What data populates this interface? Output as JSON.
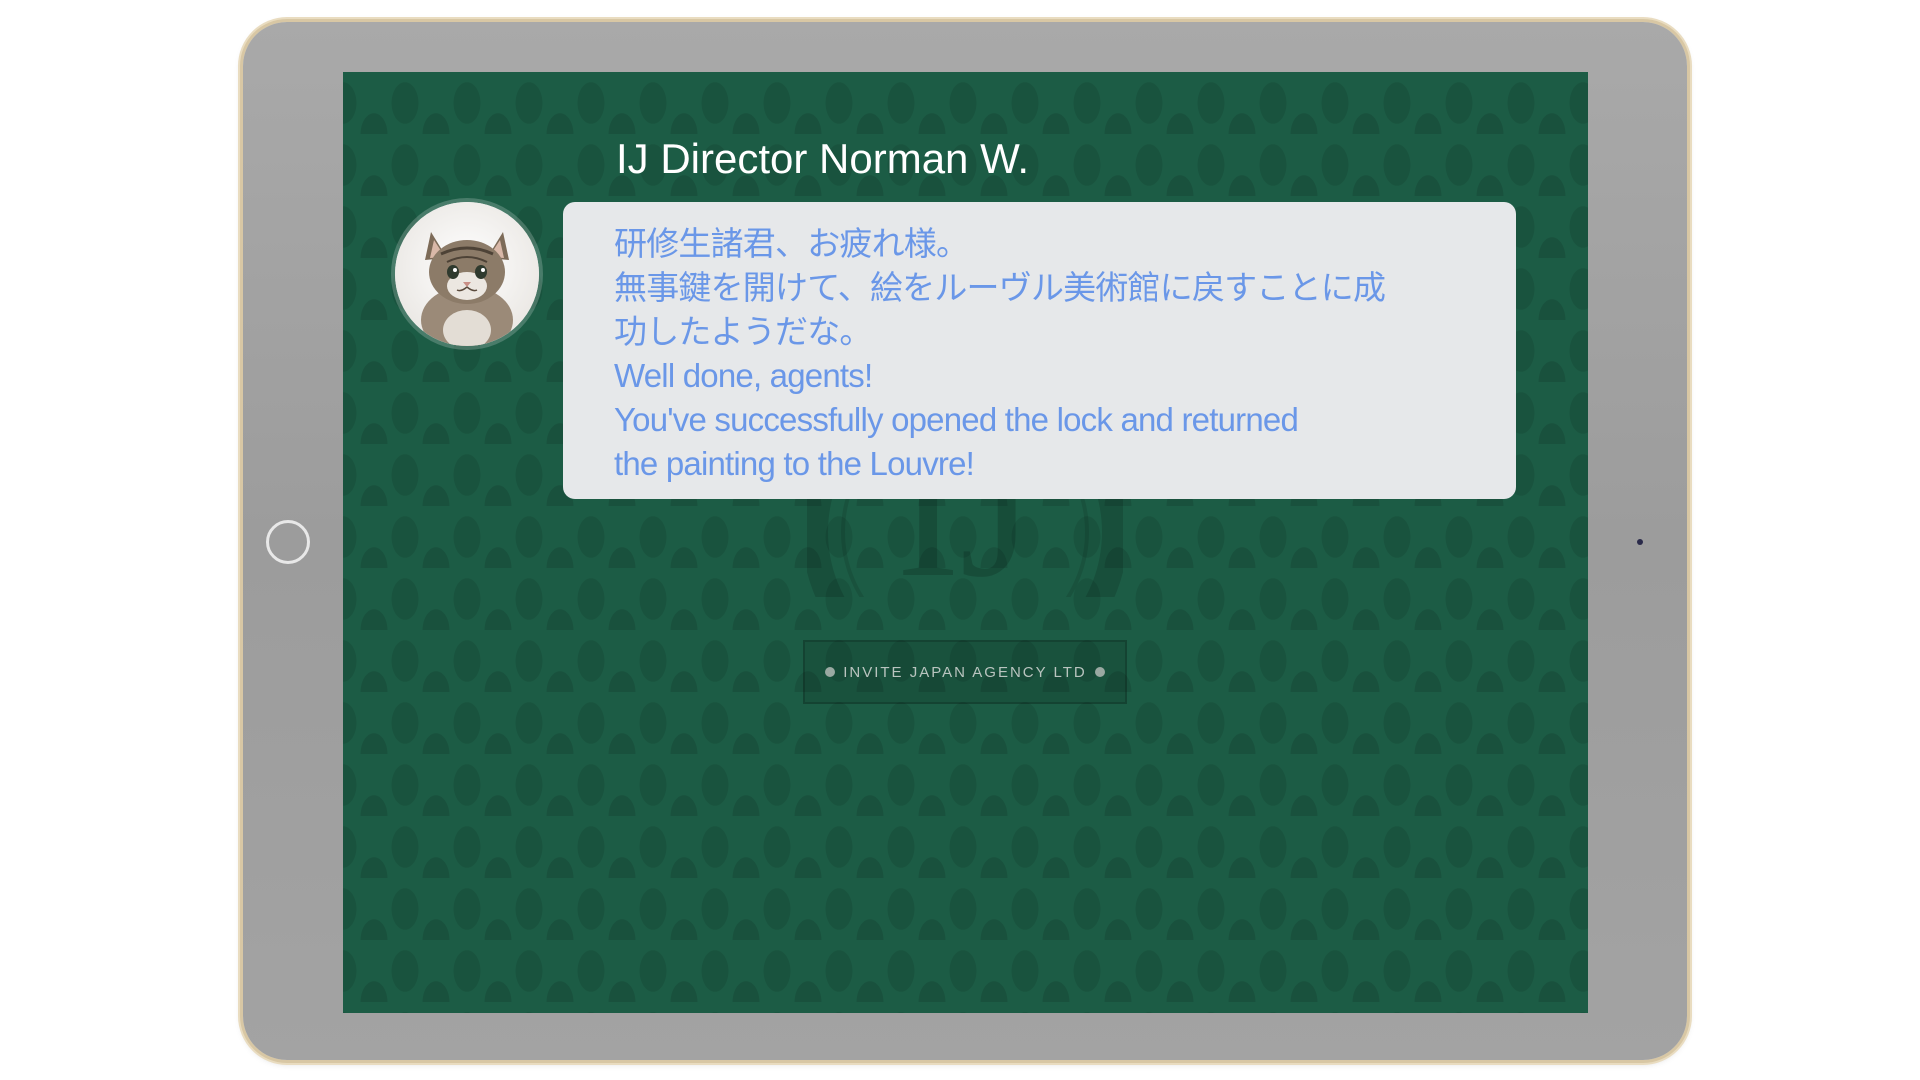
{
  "dialog": {
    "speaker": "IJ Director Norman W.",
    "lines": [
      "研修生諸君、お疲れ様。",
      "無事鍵を開けて、絵をルーヴル美術館に戻すことに成",
      "功したようだな。",
      "Well done, agents!",
      "You've successfully opened the lock and returned",
      "the painting to the Louvre!"
    ],
    "text_color": "#6a97e8"
  },
  "logo": {
    "monogram": "IJ",
    "agency": "INVITE JAPAN AGENCY LTD"
  },
  "colors": {
    "screen_background": "#1c5c45",
    "bubble_background": "#e6e8ea",
    "tablet_frame": "#a3a3a3"
  },
  "icons": {
    "avatar": "kitten-avatar",
    "home": "home-button-icon"
  }
}
